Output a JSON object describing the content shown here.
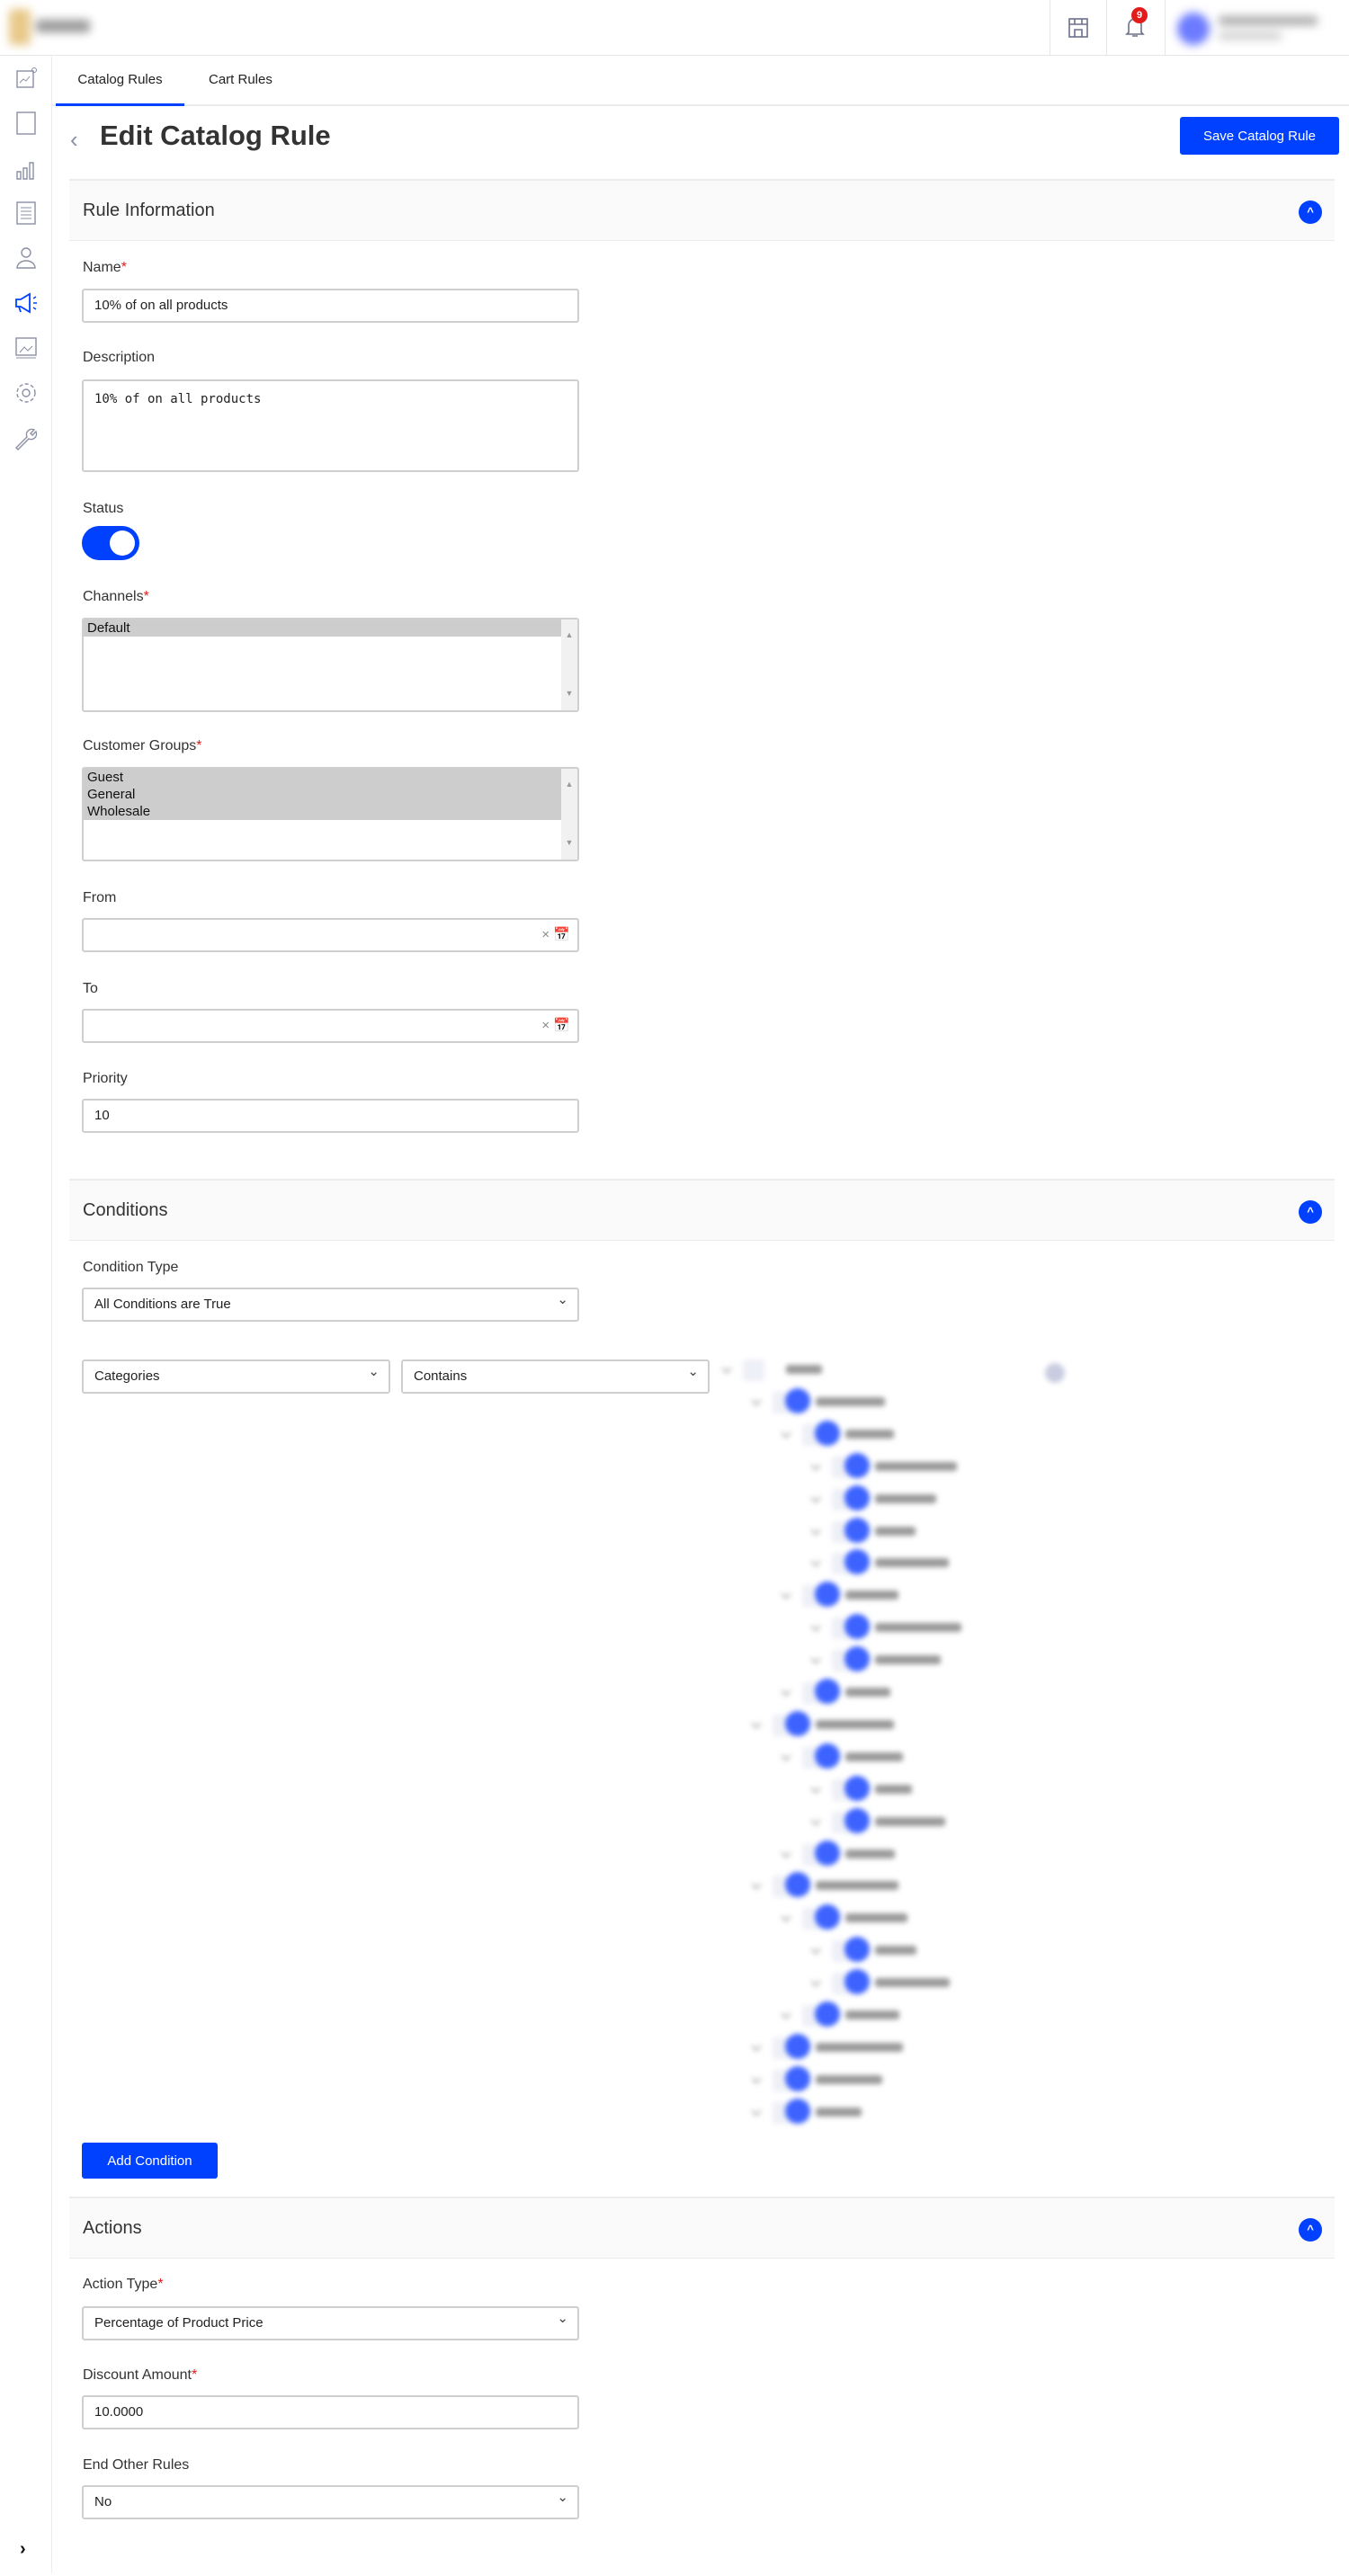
{
  "header": {
    "notifications_count": "9"
  },
  "tabs": [
    {
      "label": "Catalog Rules",
      "active": true
    },
    {
      "label": "Cart Rules",
      "active": false
    }
  ],
  "page": {
    "title": "Edit Catalog Rule",
    "save_label": "Save Catalog Rule"
  },
  "rule_information": {
    "title": "Rule Information",
    "name_label": "Name",
    "name_value": "10% of on all products",
    "description_label": "Description",
    "description_value": "10% of on all products",
    "status_label": "Status",
    "status_on": true,
    "channels_label": "Channels",
    "channels_options": [
      "Default"
    ],
    "customer_groups_label": "Customer Groups",
    "customer_groups_options": [
      "Guest",
      "General",
      "Wholesale"
    ],
    "from_label": "From",
    "from_value": "",
    "to_label": "To",
    "to_value": "",
    "priority_label": "Priority",
    "priority_value": "10"
  },
  "conditions": {
    "title": "Conditions",
    "condition_type_label": "Condition Type",
    "condition_type_value": "All Conditions are True",
    "attribute_value": "Categories",
    "operator_value": "Contains",
    "category_tree_levels": [
      0,
      1,
      2,
      3,
      3,
      3,
      3,
      2,
      3,
      3,
      2,
      1,
      2,
      3,
      3,
      2,
      1,
      2,
      3,
      3,
      2,
      1,
      1,
      1
    ],
    "add_condition_label": "Add Condition"
  },
  "actions": {
    "title": "Actions",
    "action_type_label": "Action Type",
    "action_type_value": "Percentage of Product Price",
    "discount_amount_label": "Discount Amount",
    "discount_amount_value": "10.0000",
    "end_other_rules_label": "End Other Rules",
    "end_other_rules_value": "No"
  },
  "colors": {
    "accent": "#0041ff",
    "required": "#e21b1b",
    "badge": "#e21b1b"
  }
}
